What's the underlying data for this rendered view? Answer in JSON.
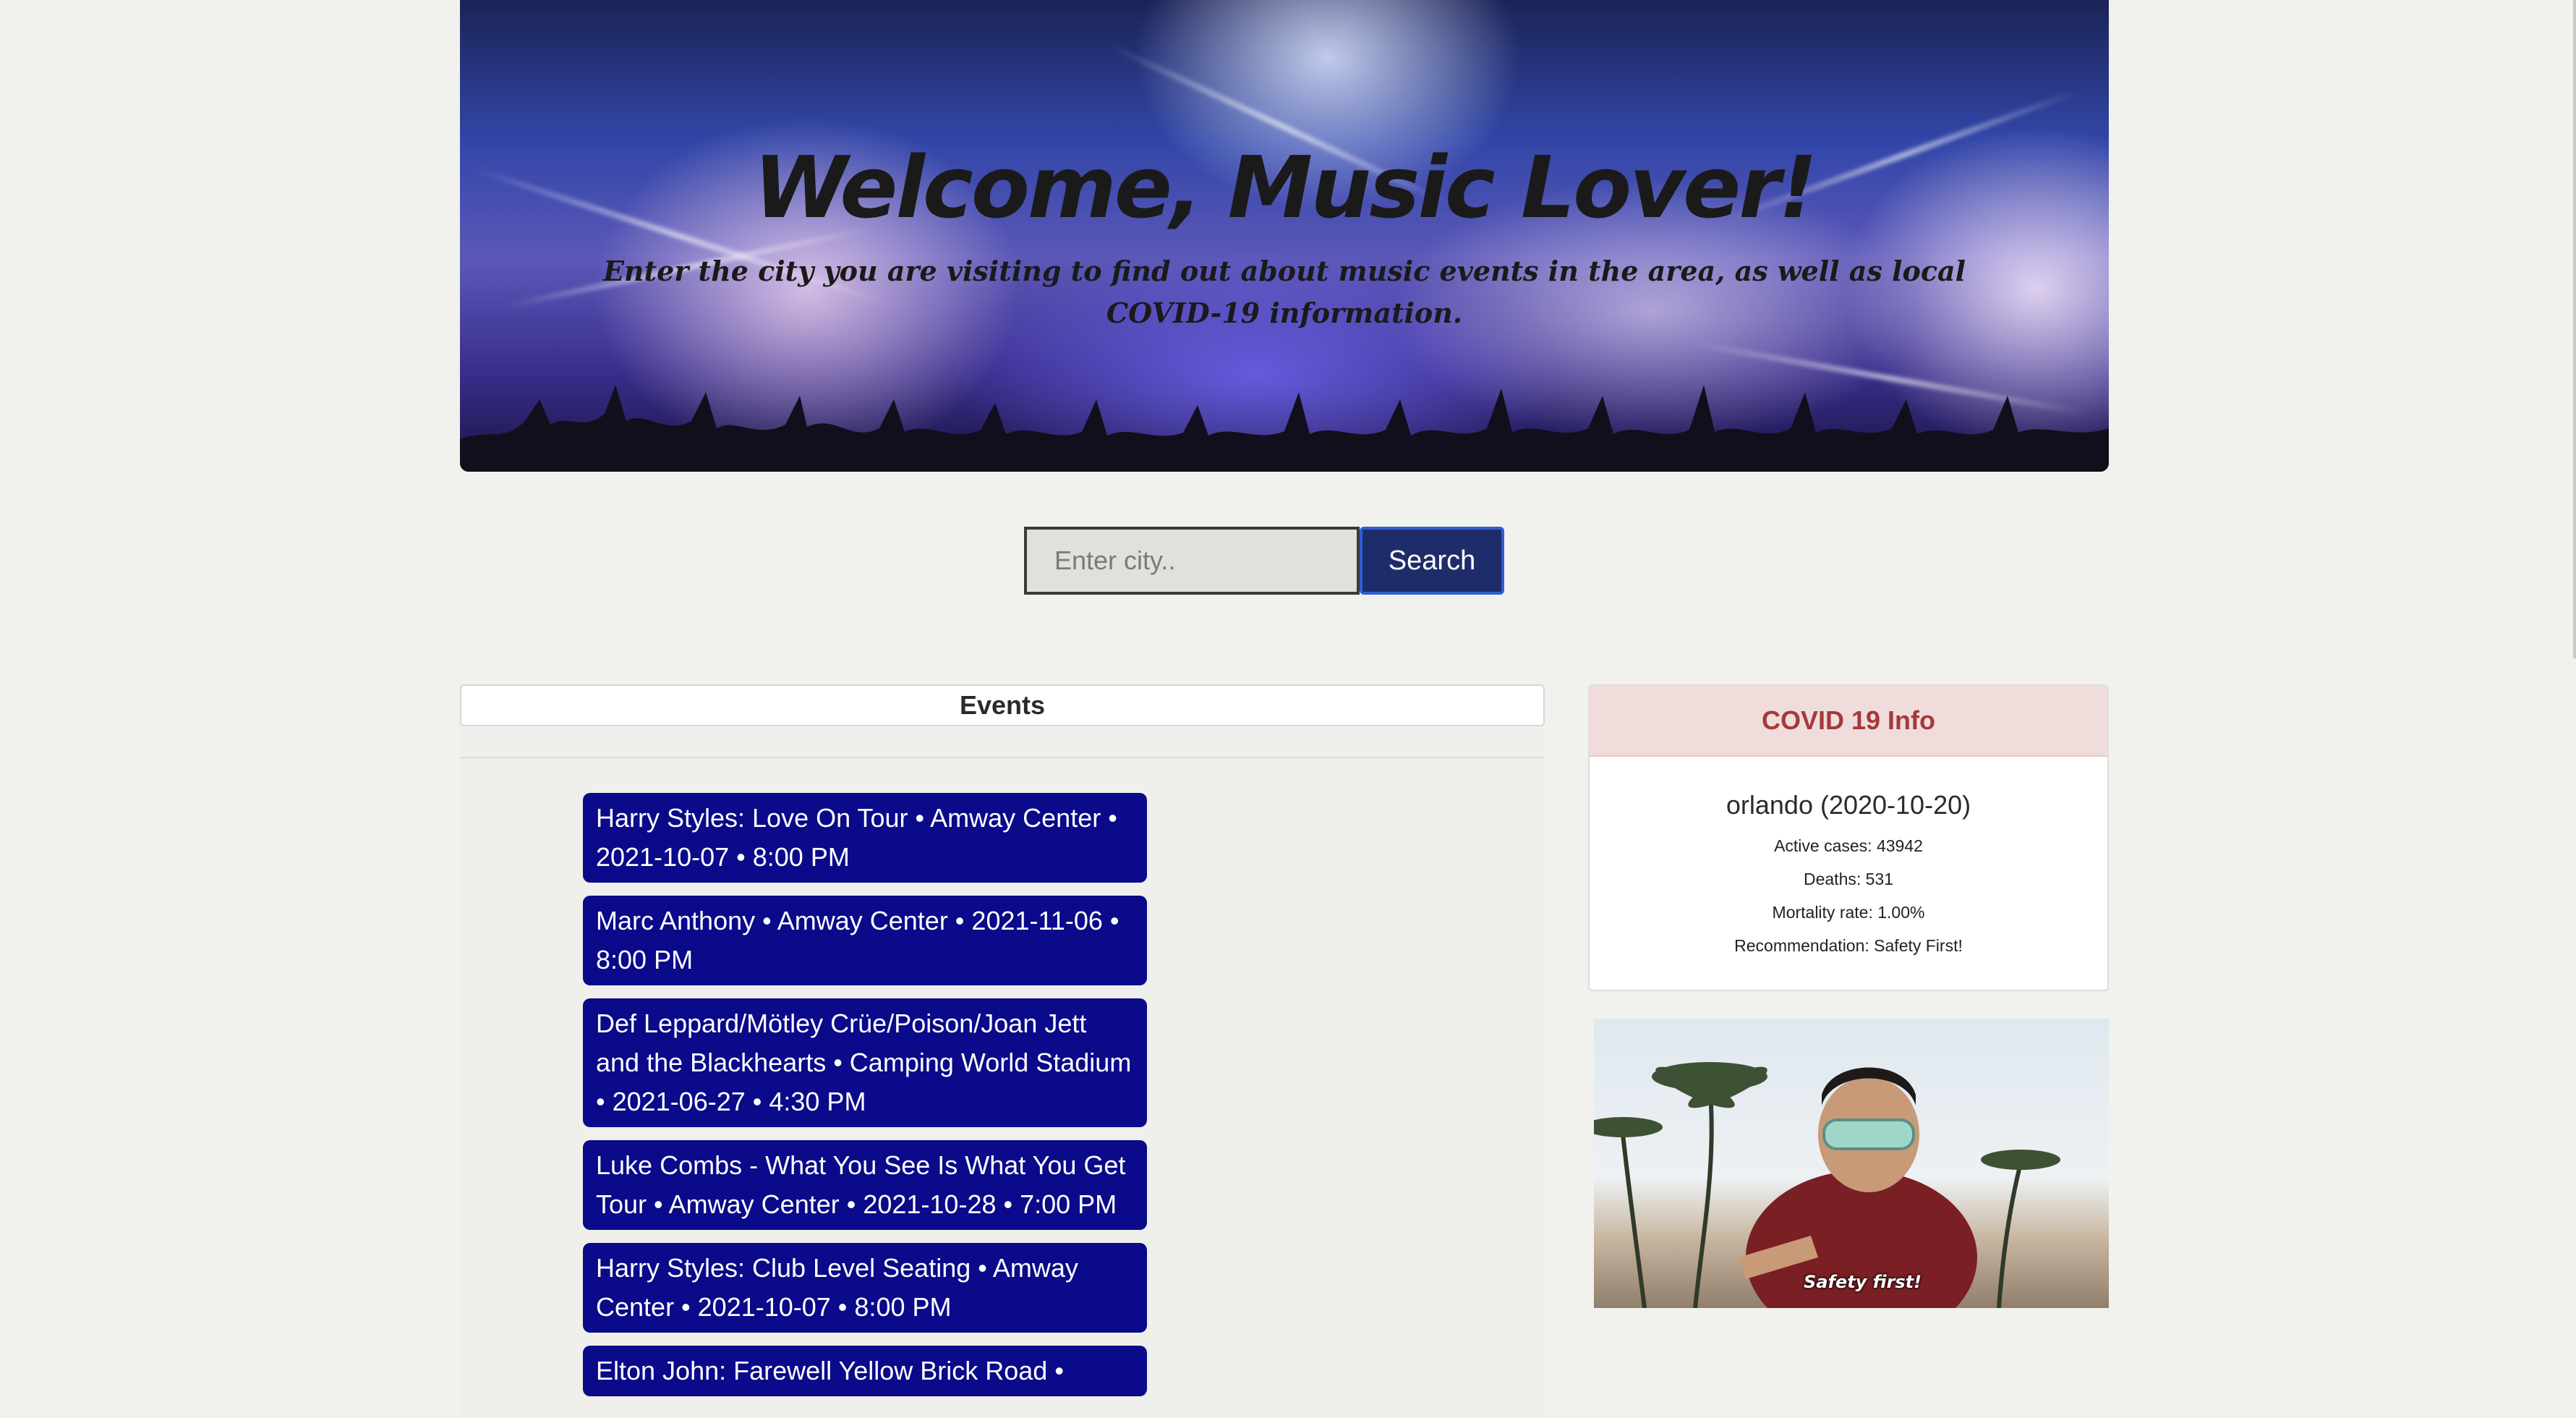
{
  "hero": {
    "title": "Welcome, Music Lover!",
    "subtitle": "Enter the city you are visiting to find out about music events in the area, as well as local COVID-19 information."
  },
  "search": {
    "placeholder": "Enter city..",
    "value": "",
    "button_label": "Search"
  },
  "events": {
    "header": "Events",
    "items": [
      {
        "label": "Harry Styles: Love On Tour • Amway Center • 2021-10-07 • 8:00 PM"
      },
      {
        "label": "Marc Anthony • Amway Center • 2021-11-06 • 8:00 PM"
      },
      {
        "label": "Def Leppard/Mötley Crüe/Poison/Joan Jett and the Blackhearts • Camping World Stadium • 2021-06-27 • 4:30 PM"
      },
      {
        "label": "Luke Combs - What You See Is What You Get Tour • Amway Center • 2021-10-28 • 7:00 PM"
      },
      {
        "label": "Harry Styles: Club Level Seating • Amway Center • 2021-10-07 • 8:00 PM"
      },
      {
        "label": "Elton John: Farewell Yellow Brick Road •"
      }
    ]
  },
  "covid": {
    "header": "COVID 19 Info",
    "city_line": "orlando (2020-10-20)",
    "active_cases": "Active cases: 43942",
    "deaths": "Deaths: 531",
    "mortality_rate": "Mortality rate: 1.00%",
    "recommendation": "Recommendation: Safety First!",
    "gif_caption": "Safety first!"
  },
  "colors": {
    "event_card": "#0a0a8a",
    "search_button": "#1f2c6a",
    "covid_header_bg": "#f1dcdc",
    "covid_header_text": "#a33a3a",
    "page_bg": "#f1f1ee"
  }
}
